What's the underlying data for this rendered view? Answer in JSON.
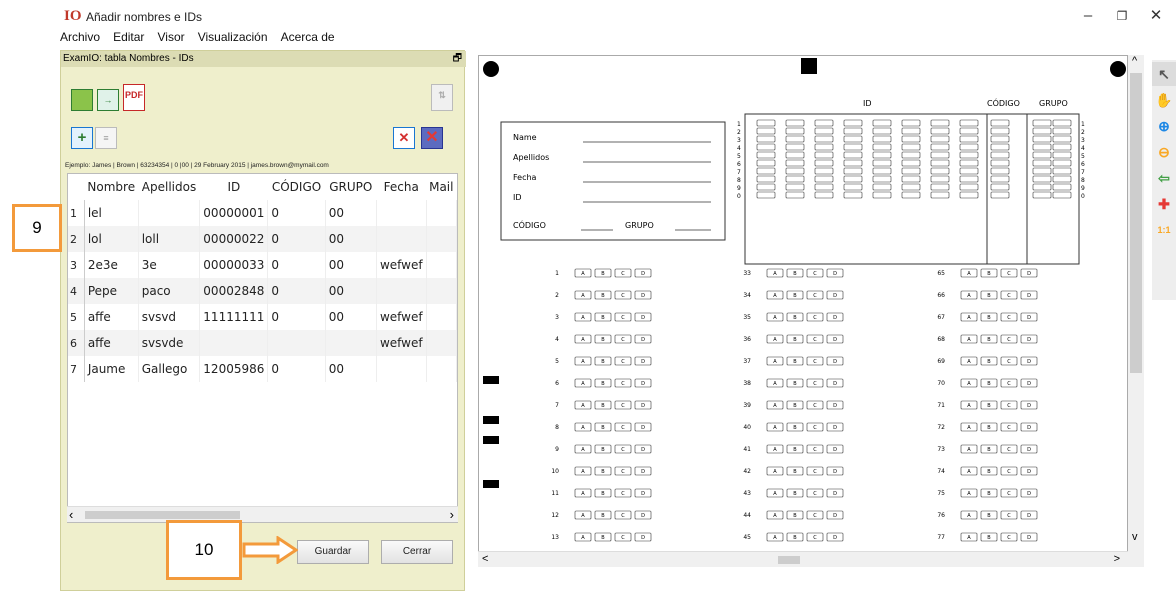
{
  "window": {
    "logo": "IO",
    "title": "Añadir nombres e IDs",
    "minimize": "–",
    "maximize": "❐",
    "close": "✕"
  },
  "menu": [
    "Archivo",
    "Editar",
    "Visor",
    "Visualización",
    "Acerca de"
  ],
  "panel": {
    "title": "ExamIO: tabla Nombres - IDs",
    "float": "🗗"
  },
  "toolbar": {
    "pdf_label": "PDF"
  },
  "example": "Ejemplo: James | Brown | 63234354 | 0 |00 | 29 February 2015 | james.brown@mymail.com",
  "table": {
    "columns": [
      "Nombre",
      "Apellidos",
      "ID",
      "CÓDIGO",
      "GRUPO",
      "Fecha",
      "Mail"
    ],
    "rows": [
      {
        "n": "1",
        "cells": [
          "lel",
          "",
          "00000001",
          "0",
          "00",
          "",
          ""
        ]
      },
      {
        "n": "2",
        "cells": [
          "lol",
          "loll",
          "00000022",
          "0",
          "00",
          "",
          ""
        ]
      },
      {
        "n": "3",
        "cells": [
          "2e3e",
          "3e",
          "00000033",
          "0",
          "00",
          "wefwef",
          ""
        ]
      },
      {
        "n": "4",
        "cells": [
          "Pepe",
          "paco",
          "00002848",
          "0",
          "00",
          "",
          ""
        ]
      },
      {
        "n": "5",
        "cells": [
          "affe",
          "svsvd",
          "11111111",
          "0",
          "00",
          "wefwef",
          ""
        ]
      },
      {
        "n": "6",
        "cells": [
          "affe",
          "svsvde",
          "",
          "",
          "",
          "wefwef",
          ""
        ]
      },
      {
        "n": "7",
        "cells": [
          "Jaume",
          "Gallego",
          "12005986",
          "0",
          "00",
          "",
          ""
        ]
      }
    ]
  },
  "buttons": {
    "save": "Guardar",
    "close": "Cerrar"
  },
  "annotations": {
    "step9": "9",
    "step10": "10"
  },
  "sheet": {
    "fields": [
      "Name",
      "Apellidos",
      "Fecha",
      "ID"
    ],
    "code_label": "CÓDIGO",
    "group_label": "GRUPO",
    "id_header": "ID",
    "code_header": "CÓDIGO",
    "group_header": "GRUPO",
    "digits": [
      "1",
      "2",
      "3",
      "4",
      "5",
      "6",
      "7",
      "8",
      "9",
      "0"
    ],
    "choices": [
      "A",
      "B",
      "C",
      "D"
    ],
    "col1": [
      "1",
      "2",
      "3",
      "4",
      "5",
      "6",
      "7",
      "8",
      "9",
      "10",
      "11",
      "12",
      "13"
    ],
    "col2": [
      "33",
      "34",
      "35",
      "36",
      "37",
      "38",
      "39",
      "40",
      "41",
      "42",
      "43",
      "44",
      "45"
    ],
    "col3": [
      "65",
      "66",
      "67",
      "68",
      "69",
      "70",
      "71",
      "72",
      "73",
      "74",
      "75",
      "76",
      "77"
    ]
  },
  "scroll": {
    "left": "‹",
    "right": "›",
    "left2": "<",
    "right2": ">",
    "up": "^",
    "down": "v"
  },
  "right_tools": [
    "↖",
    "✋",
    "⊕",
    "⊖",
    "⇦",
    "✚",
    "1:1"
  ]
}
